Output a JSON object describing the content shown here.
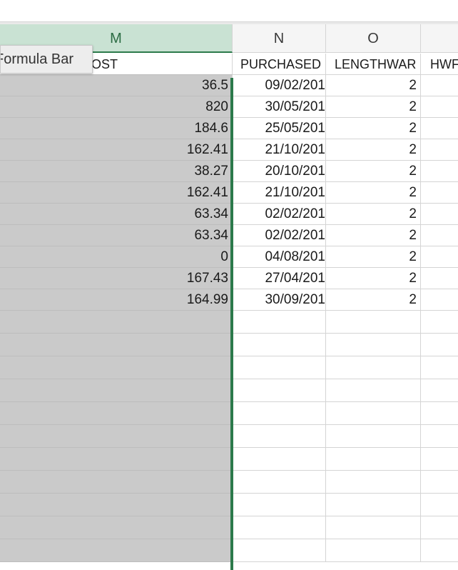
{
  "tooltip": {
    "text": "Formula Bar"
  },
  "columns": {
    "m": "M",
    "n": "N",
    "o": "O"
  },
  "headers": {
    "m": "COST",
    "n": "PURCHASED",
    "o": "LENGTHWAR",
    "p": "HWF"
  },
  "rows": [
    {
      "m": "36.5",
      "n": "09/02/201",
      "o": "2"
    },
    {
      "m": "820",
      "n": "30/05/201",
      "o": "2"
    },
    {
      "m": "184.6",
      "n": "25/05/201",
      "o": "2"
    },
    {
      "m": "162.41",
      "n": "21/10/201",
      "o": "2"
    },
    {
      "m": "38.27",
      "n": "20/10/201",
      "o": "2"
    },
    {
      "m": "162.41",
      "n": "21/10/201",
      "o": "2"
    },
    {
      "m": "63.34",
      "n": "02/02/201",
      "o": "2"
    },
    {
      "m": "63.34",
      "n": "02/02/201",
      "o": "2"
    },
    {
      "m": "0",
      "n": "04/08/201",
      "o": "2"
    },
    {
      "m": "167.43",
      "n": "27/04/201",
      "o": "2"
    },
    {
      "m": "164.99",
      "n": "30/09/201",
      "o": "2"
    }
  ],
  "empty_rows": 11,
  "colors": {
    "selected_column": "#c9e2d3",
    "selection_border": "#2c7a4b",
    "selected_cells": "#cacaca"
  }
}
